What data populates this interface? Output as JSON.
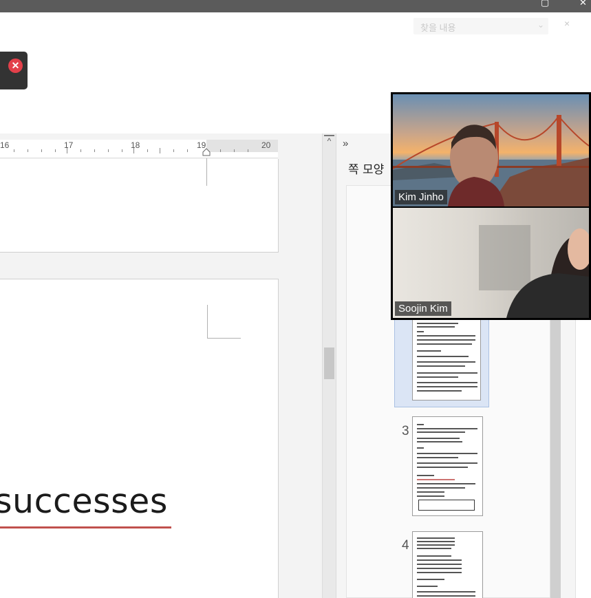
{
  "window": {
    "restore_glyph": "▢",
    "close_glyph": "✕"
  },
  "ribbon": {
    "search_placeholder": "찾을 내용",
    "chevron": "⌄",
    "close": "×"
  },
  "notification": {
    "close_glyph": "✕"
  },
  "ruler": {
    "labels": [
      "16",
      "17",
      "18",
      "19",
      "20"
    ]
  },
  "document": {
    "visible_word": "successes"
  },
  "scrollbar": {
    "up_glyph": "^"
  },
  "panel": {
    "expand_glyph": "»",
    "title": "쪽 모양",
    "page_numbers": [
      "3",
      "4"
    ]
  },
  "video_call": {
    "participants": [
      {
        "name": "Kim Jinho"
      },
      {
        "name": "Soojin Kim"
      }
    ]
  },
  "colors": {
    "titlebar": "#5b5b5b",
    "accent_red_underline": "#c0504d",
    "close_badge": "#e3404a",
    "selection": "#dbe5f5"
  }
}
